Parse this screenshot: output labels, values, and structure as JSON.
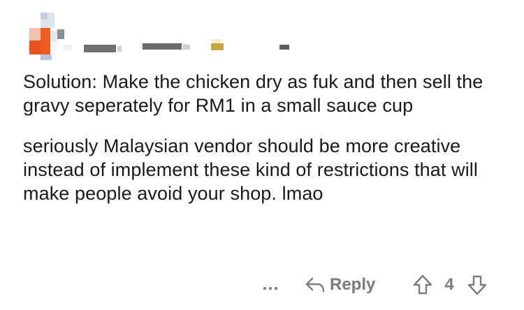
{
  "comment": {
    "body": [
      "Solution: Make the chicken dry as fuk and then sell the gravy seperately for RM1 in a small sauce cup",
      "seriously Malaysian vendor should be more creative instead of implement these kind of restrictions that will make people avoid your shop. lmao"
    ]
  },
  "actions": {
    "more_label": "...",
    "reply_label": "Reply",
    "vote_count": "4"
  },
  "colors": {
    "text": "#1a1a1b",
    "meta": "#7a7c7e",
    "avatar_orange": "#e8531f"
  },
  "icons": {
    "more": "more-icon",
    "reply": "reply-icon",
    "upvote": "upvote-icon",
    "downvote": "downvote-icon"
  }
}
